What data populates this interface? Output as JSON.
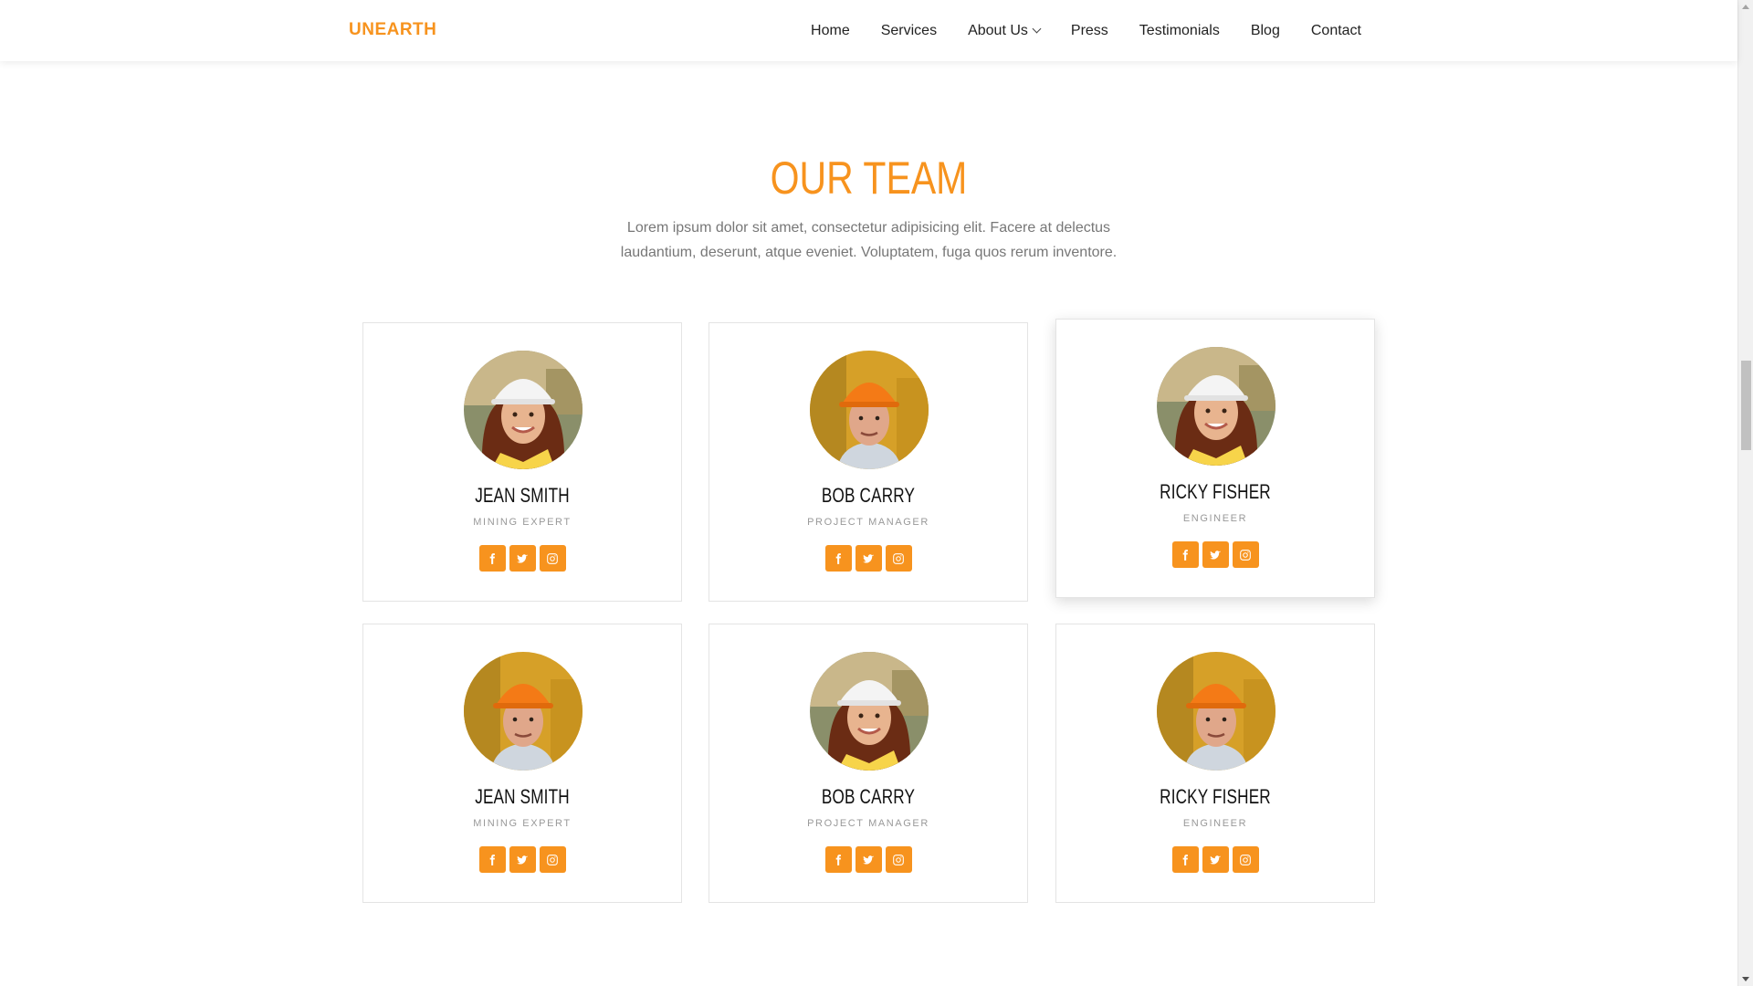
{
  "colors": {
    "accent": "#f7931e",
    "accent_dark": "#e8860f",
    "text": "#222222",
    "muted": "#777777"
  },
  "nav": {
    "brand": "UNEARTH",
    "links": [
      {
        "label": "Home"
      },
      {
        "label": "Services"
      },
      {
        "label": "About Us",
        "has_dropdown": true
      },
      {
        "label": "Press"
      },
      {
        "label": "Testimonials"
      },
      {
        "label": "Blog"
      },
      {
        "label": "Contact"
      }
    ]
  },
  "team": {
    "title": "OUR TEAM",
    "description": "Lorem ipsum dolor sit amet, consectetur adipisicing elit. Facere at delectus laudantium, deserunt, atque eveniet. Voluptatem, fuga quos rerum inventore.",
    "members": [
      {
        "name": "JEAN SMITH",
        "role": "MINING EXPERT",
        "photo": "woman-white-helmet"
      },
      {
        "name": "BOB CARRY",
        "role": "PROJECT MANAGER",
        "photo": "man-orange-helmet"
      },
      {
        "name": "RICKY FISHER",
        "role": "ENGINEER",
        "photo": "woman-white-helmet"
      },
      {
        "name": "JEAN SMITH",
        "role": "MINING EXPERT",
        "photo": "man-orange-helmet"
      },
      {
        "name": "BOB CARRY",
        "role": "PROJECT MANAGER",
        "photo": "woman-white-helmet"
      },
      {
        "name": "RICKY FISHER",
        "role": "ENGINEER",
        "photo": "man-orange-helmet"
      }
    ],
    "social_icons": [
      "facebook-icon",
      "twitter-icon",
      "instagram-icon"
    ]
  }
}
